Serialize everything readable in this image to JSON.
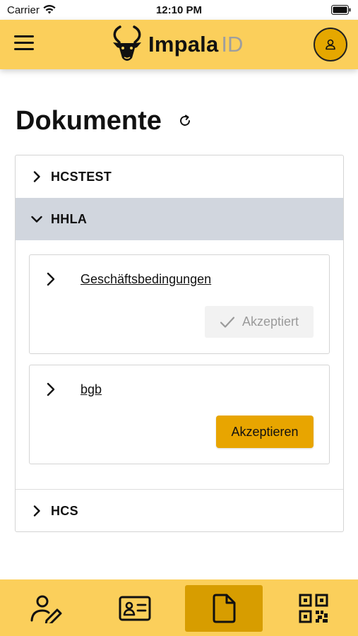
{
  "status_bar": {
    "carrier": "Carrier",
    "time": "12:10 PM"
  },
  "header": {
    "logo_main": "Impala",
    "logo_accent": "ID",
    "brand_color": "#fbcf5b",
    "menu_icon": "hamburger-icon",
    "profile_icon": "user-icon"
  },
  "page": {
    "title": "Dokumente",
    "refresh_icon": "refresh-icon"
  },
  "accordion": {
    "sections": [
      {
        "label": "HCSTEST",
        "expanded": false
      },
      {
        "label": "HHLA",
        "expanded": true
      },
      {
        "label": "HCS",
        "expanded": false
      }
    ],
    "documents": [
      {
        "title": "Geschäftsbedingungen",
        "status": "accepted",
        "action_label": "Akzeptiert"
      },
      {
        "title": "bgb",
        "status": "pending",
        "action_label": "Akzeptieren"
      }
    ]
  },
  "bottom_nav": {
    "items": [
      {
        "icon": "signature-icon",
        "active": false
      },
      {
        "icon": "id-card-icon",
        "active": false
      },
      {
        "icon": "document-icon",
        "active": true
      },
      {
        "icon": "qr-code-icon",
        "active": false
      }
    ]
  },
  "colors": {
    "accent": "#e8a500",
    "active_nav": "#d79d00",
    "expanded_section": "#d1d6de"
  }
}
